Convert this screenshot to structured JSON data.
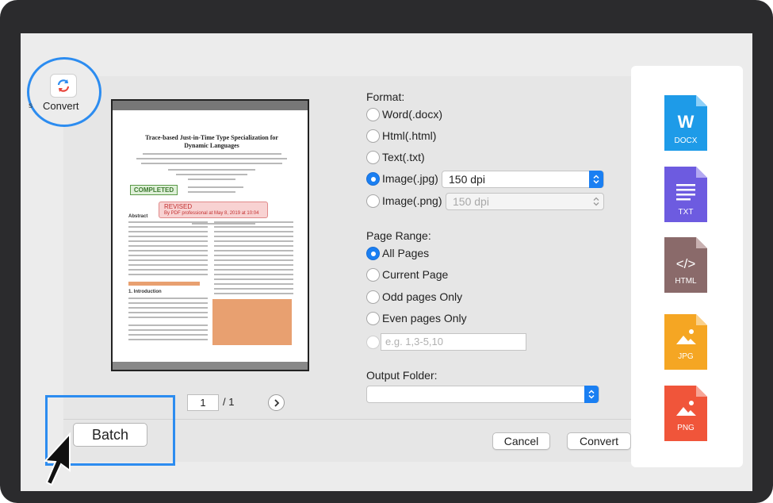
{
  "toolbar": {
    "convert_label": "Convert",
    "left_mark": "s"
  },
  "preview": {
    "doc_title": "Trace-based Just-in-Time Type Specialization for Dynamic Languages",
    "completed_stamp": "COMPLETED",
    "revised_stamp": "REVISED",
    "revised_note": "By PDF professional at May 8, 2019 at 10:04",
    "abstract_heading": "Abstract",
    "intro_heading": "1. Introduction"
  },
  "pager": {
    "page": "1",
    "total": "/ 1"
  },
  "format": {
    "heading": "Format:",
    "options": [
      {
        "label": "Word(.docx)",
        "selected": false
      },
      {
        "label": "Html(.html)",
        "selected": false
      },
      {
        "label": "Text(.txt)",
        "selected": false
      },
      {
        "label": "Image(.jpg)",
        "selected": true,
        "dpi": "150 dpi"
      },
      {
        "label": "Image(.png)",
        "selected": false,
        "dpi": "150 dpi"
      }
    ]
  },
  "page_range": {
    "heading": "Page Range:",
    "options": [
      {
        "label": "All Pages",
        "selected": true
      },
      {
        "label": "Current Page",
        "selected": false
      },
      {
        "label": "Odd pages Only",
        "selected": false
      },
      {
        "label": "Even pages Only",
        "selected": false
      }
    ],
    "custom_placeholder": "e.g. 1,3-5,10"
  },
  "output": {
    "heading": "Output Folder:",
    "value": ""
  },
  "buttons": {
    "cancel": "Cancel",
    "convert": "Convert",
    "batch": "Batch"
  },
  "format_icons": [
    {
      "name": "docx",
      "glyph": "W",
      "label": "DOCX",
      "color": "#1e9be8"
    },
    {
      "name": "txt",
      "glyph": "≡",
      "label": "TXT",
      "color": "#6d5be0"
    },
    {
      "name": "html",
      "glyph": "</>",
      "label": "HTML",
      "color": "#8a6a6a"
    },
    {
      "name": "jpg",
      "glyph": "▲",
      "label": "JPG",
      "color": "#f5a623"
    },
    {
      "name": "png",
      "glyph": "▲",
      "label": "PNG",
      "color": "#f0553a"
    }
  ],
  "colors": {
    "accent": "#1a7ff2",
    "highlight": "#2c8cf0"
  }
}
